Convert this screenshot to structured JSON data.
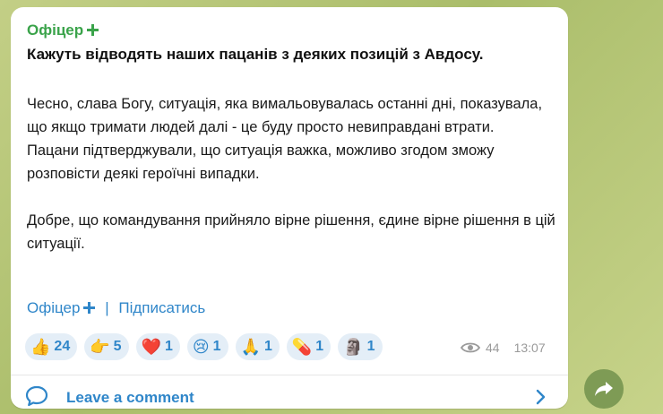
{
  "channel": {
    "name": "Офіцер"
  },
  "post": {
    "headline": "Кажуть відводять наших пацанів з деяких позицій з Авдосу.",
    "paragraphs": [
      "Чесно, слава Богу, ситуація, яка вимальовувалась останні дні, показувала, що якщо тримати людей далі - це буду просто невиправдані втрати.",
      "Пацани підтверджували, що ситуація важка, можливо згодом зможу розповісти деякі героїчні випадки.",
      "Добре, що командування прийняло вірне рішення, єдине вірне рішення в цій ситуації."
    ],
    "signature": {
      "channel": "Офіцер",
      "separator": "|",
      "subscribe": "Підписатись"
    }
  },
  "reactions": [
    {
      "icon": "thumbs-up-icon",
      "emoji": "👍",
      "count": "24"
    },
    {
      "icon": "hand-pointing-icon",
      "emoji": "👉",
      "count": "5"
    },
    {
      "icon": "heart-icon",
      "emoji": "❤️",
      "count": "1"
    },
    {
      "icon": "crying-face-icon",
      "emoji": "😢",
      "count": "1"
    },
    {
      "icon": "praying-hands-icon",
      "emoji": "🙏",
      "count": "1"
    },
    {
      "icon": "pill-icon",
      "emoji": "💊",
      "count": "1"
    },
    {
      "icon": "custom-sticker-icon",
      "emoji": "🗿",
      "count": "1"
    }
  ],
  "meta": {
    "views": "44",
    "time": "13:07"
  },
  "comments": {
    "label": "Leave a comment"
  },
  "colors": {
    "accent": "#2f86c9",
    "channel_green": "#3aa34a",
    "share_bg": "#7e9b55"
  }
}
